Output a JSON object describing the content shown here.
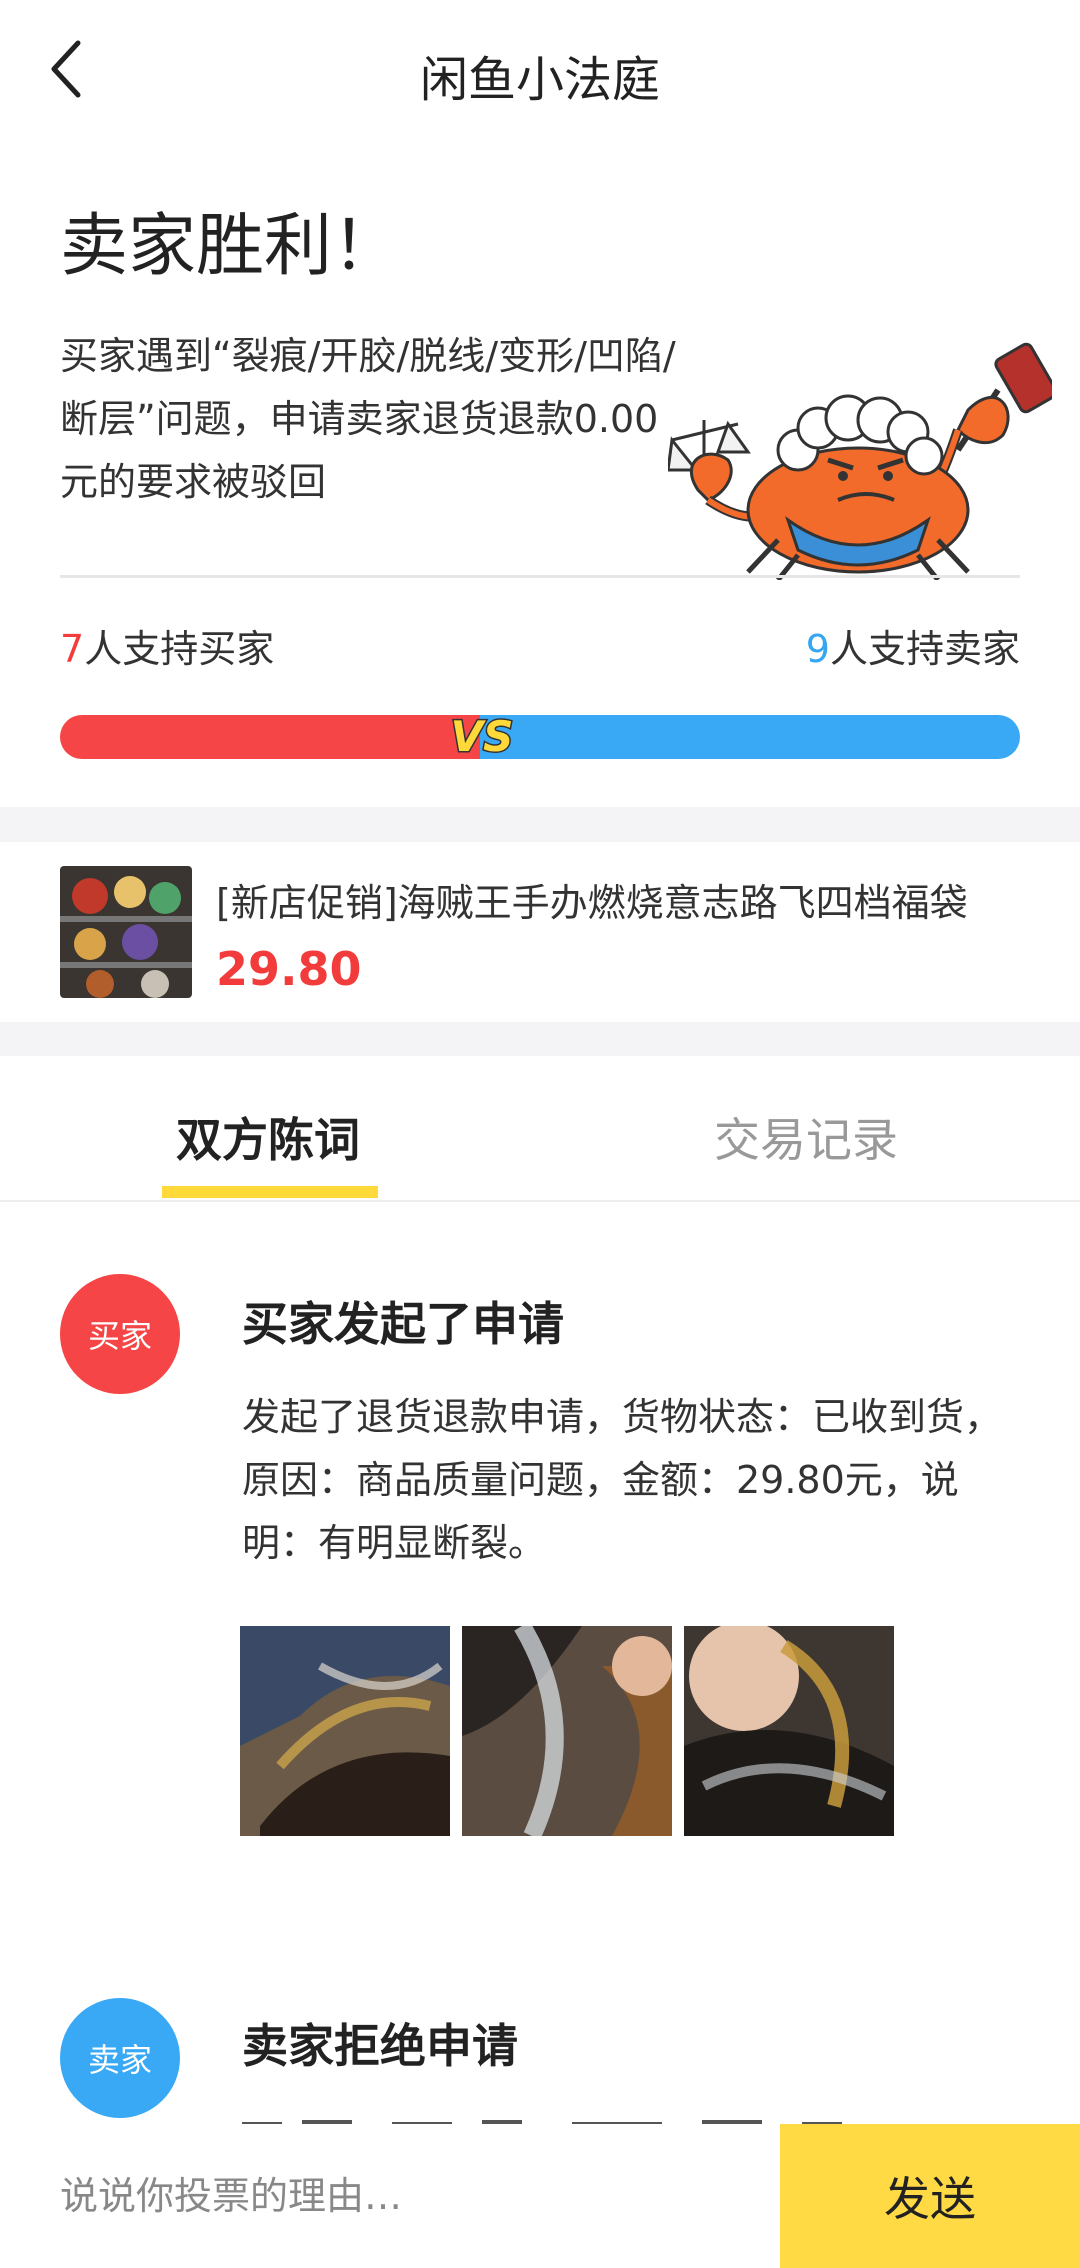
{
  "header": {
    "title": "闲鱼小法庭"
  },
  "verdict": {
    "title": "卖家胜利！",
    "description": "买家遇到“裂痕/开胶/脱线/变形/凹陷/断层”问题，申请卖家退货退款0.00元的要求被驳回"
  },
  "support": {
    "buyer_count": "7",
    "buyer_label": "人支持买家",
    "seller_count": "9",
    "seller_label": "人支持卖家",
    "buyer_ratio": 0.4375,
    "vs_label": "VS"
  },
  "product": {
    "title": "[新店促销]海贼王手办燃烧意志路飞四档福袋",
    "price": "29.80"
  },
  "tabs": [
    {
      "label": "双方陈词",
      "active": true
    },
    {
      "label": "交易记录",
      "active": false
    }
  ],
  "entries": [
    {
      "avatar_label": "买家",
      "title": "买家发起了申请",
      "text": "发起了退货退款申请，货物状态：已收到货，原因：商品质量问题，金额：29.80元，说明：有明显断裂。"
    },
    {
      "avatar_label": "卖家",
      "title": "卖家拒绝申请"
    }
  ],
  "bottom": {
    "placeholder": "说说你投票的理由…",
    "send_label": "发送"
  },
  "colors": {
    "buyer_red": "#f54546",
    "seller_blue": "#39a9f5",
    "accent_yellow": "#ffda44"
  }
}
